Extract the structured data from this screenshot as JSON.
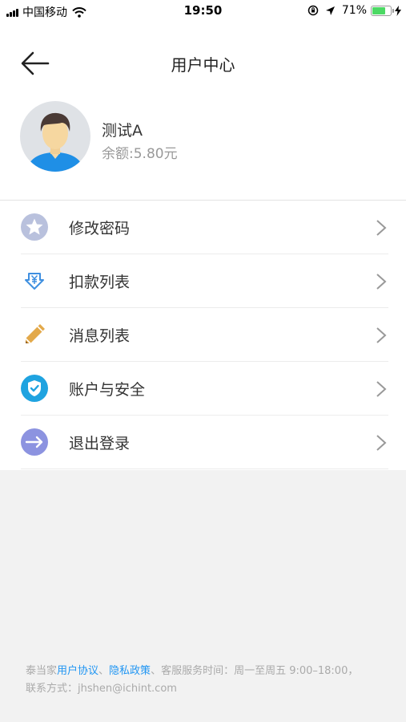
{
  "status_bar": {
    "carrier": "中国移动",
    "time": "19:50",
    "battery_percent": "71%",
    "battery_level": 0.71
  },
  "nav": {
    "title": "用户中心"
  },
  "profile": {
    "name": "测试A",
    "balance": "余额:5.80元"
  },
  "menu": [
    {
      "label": "修改密码",
      "icon": "star-icon",
      "color": "#b7c0dc"
    },
    {
      "label": "扣款列表",
      "icon": "yen-icon",
      "color": "#3f8fe0"
    },
    {
      "label": "消息列表",
      "icon": "pencil-icon",
      "color": "#e2a847"
    },
    {
      "label": "账户与安全",
      "icon": "shield-check-icon",
      "color": "#1fa3e0"
    },
    {
      "label": "退出登录",
      "icon": "logout-arrow-icon",
      "color": "#8c93e0"
    }
  ],
  "footer": {
    "brand": "泰当家",
    "user_agreement": "用户协议",
    "separator": "、",
    "privacy_policy": "隐私政策",
    "service_hours": "、客服服务时间：周一至周五 9:00–18:00，",
    "contact": "联系方式：jhshen@ichint.com"
  }
}
